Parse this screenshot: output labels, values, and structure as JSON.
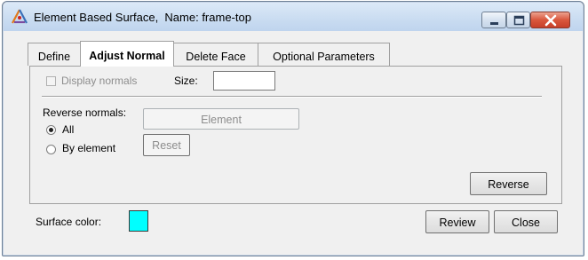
{
  "window": {
    "title": "Element Based Surface,  Name: frame-top",
    "controls": {
      "minimize_icon": "minimize-icon",
      "maximize_icon": "maximize-icon",
      "close_icon": "close-x-icon"
    }
  },
  "tabs": [
    {
      "label": "Define",
      "active": false
    },
    {
      "label": "Adjust Normal",
      "active": true
    },
    {
      "label": "Delete Face",
      "active": false
    },
    {
      "label": "Optional Parameters",
      "active": false
    }
  ],
  "adjust_normal": {
    "display_normals_label": "Display normals",
    "display_normals_checked": false,
    "size_label": "Size:",
    "size_value": "",
    "reverse_normals_label": "Reverse normals:",
    "options": [
      {
        "label": "All",
        "selected": true
      },
      {
        "label": "By element",
        "selected": false
      }
    ],
    "element_button": "Element",
    "reset_button": "Reset",
    "reverse_button": "Reverse"
  },
  "footer": {
    "surface_color_label": "Surface color:",
    "surface_color": "#00ffff",
    "review_button": "Review",
    "close_button": "Close"
  }
}
